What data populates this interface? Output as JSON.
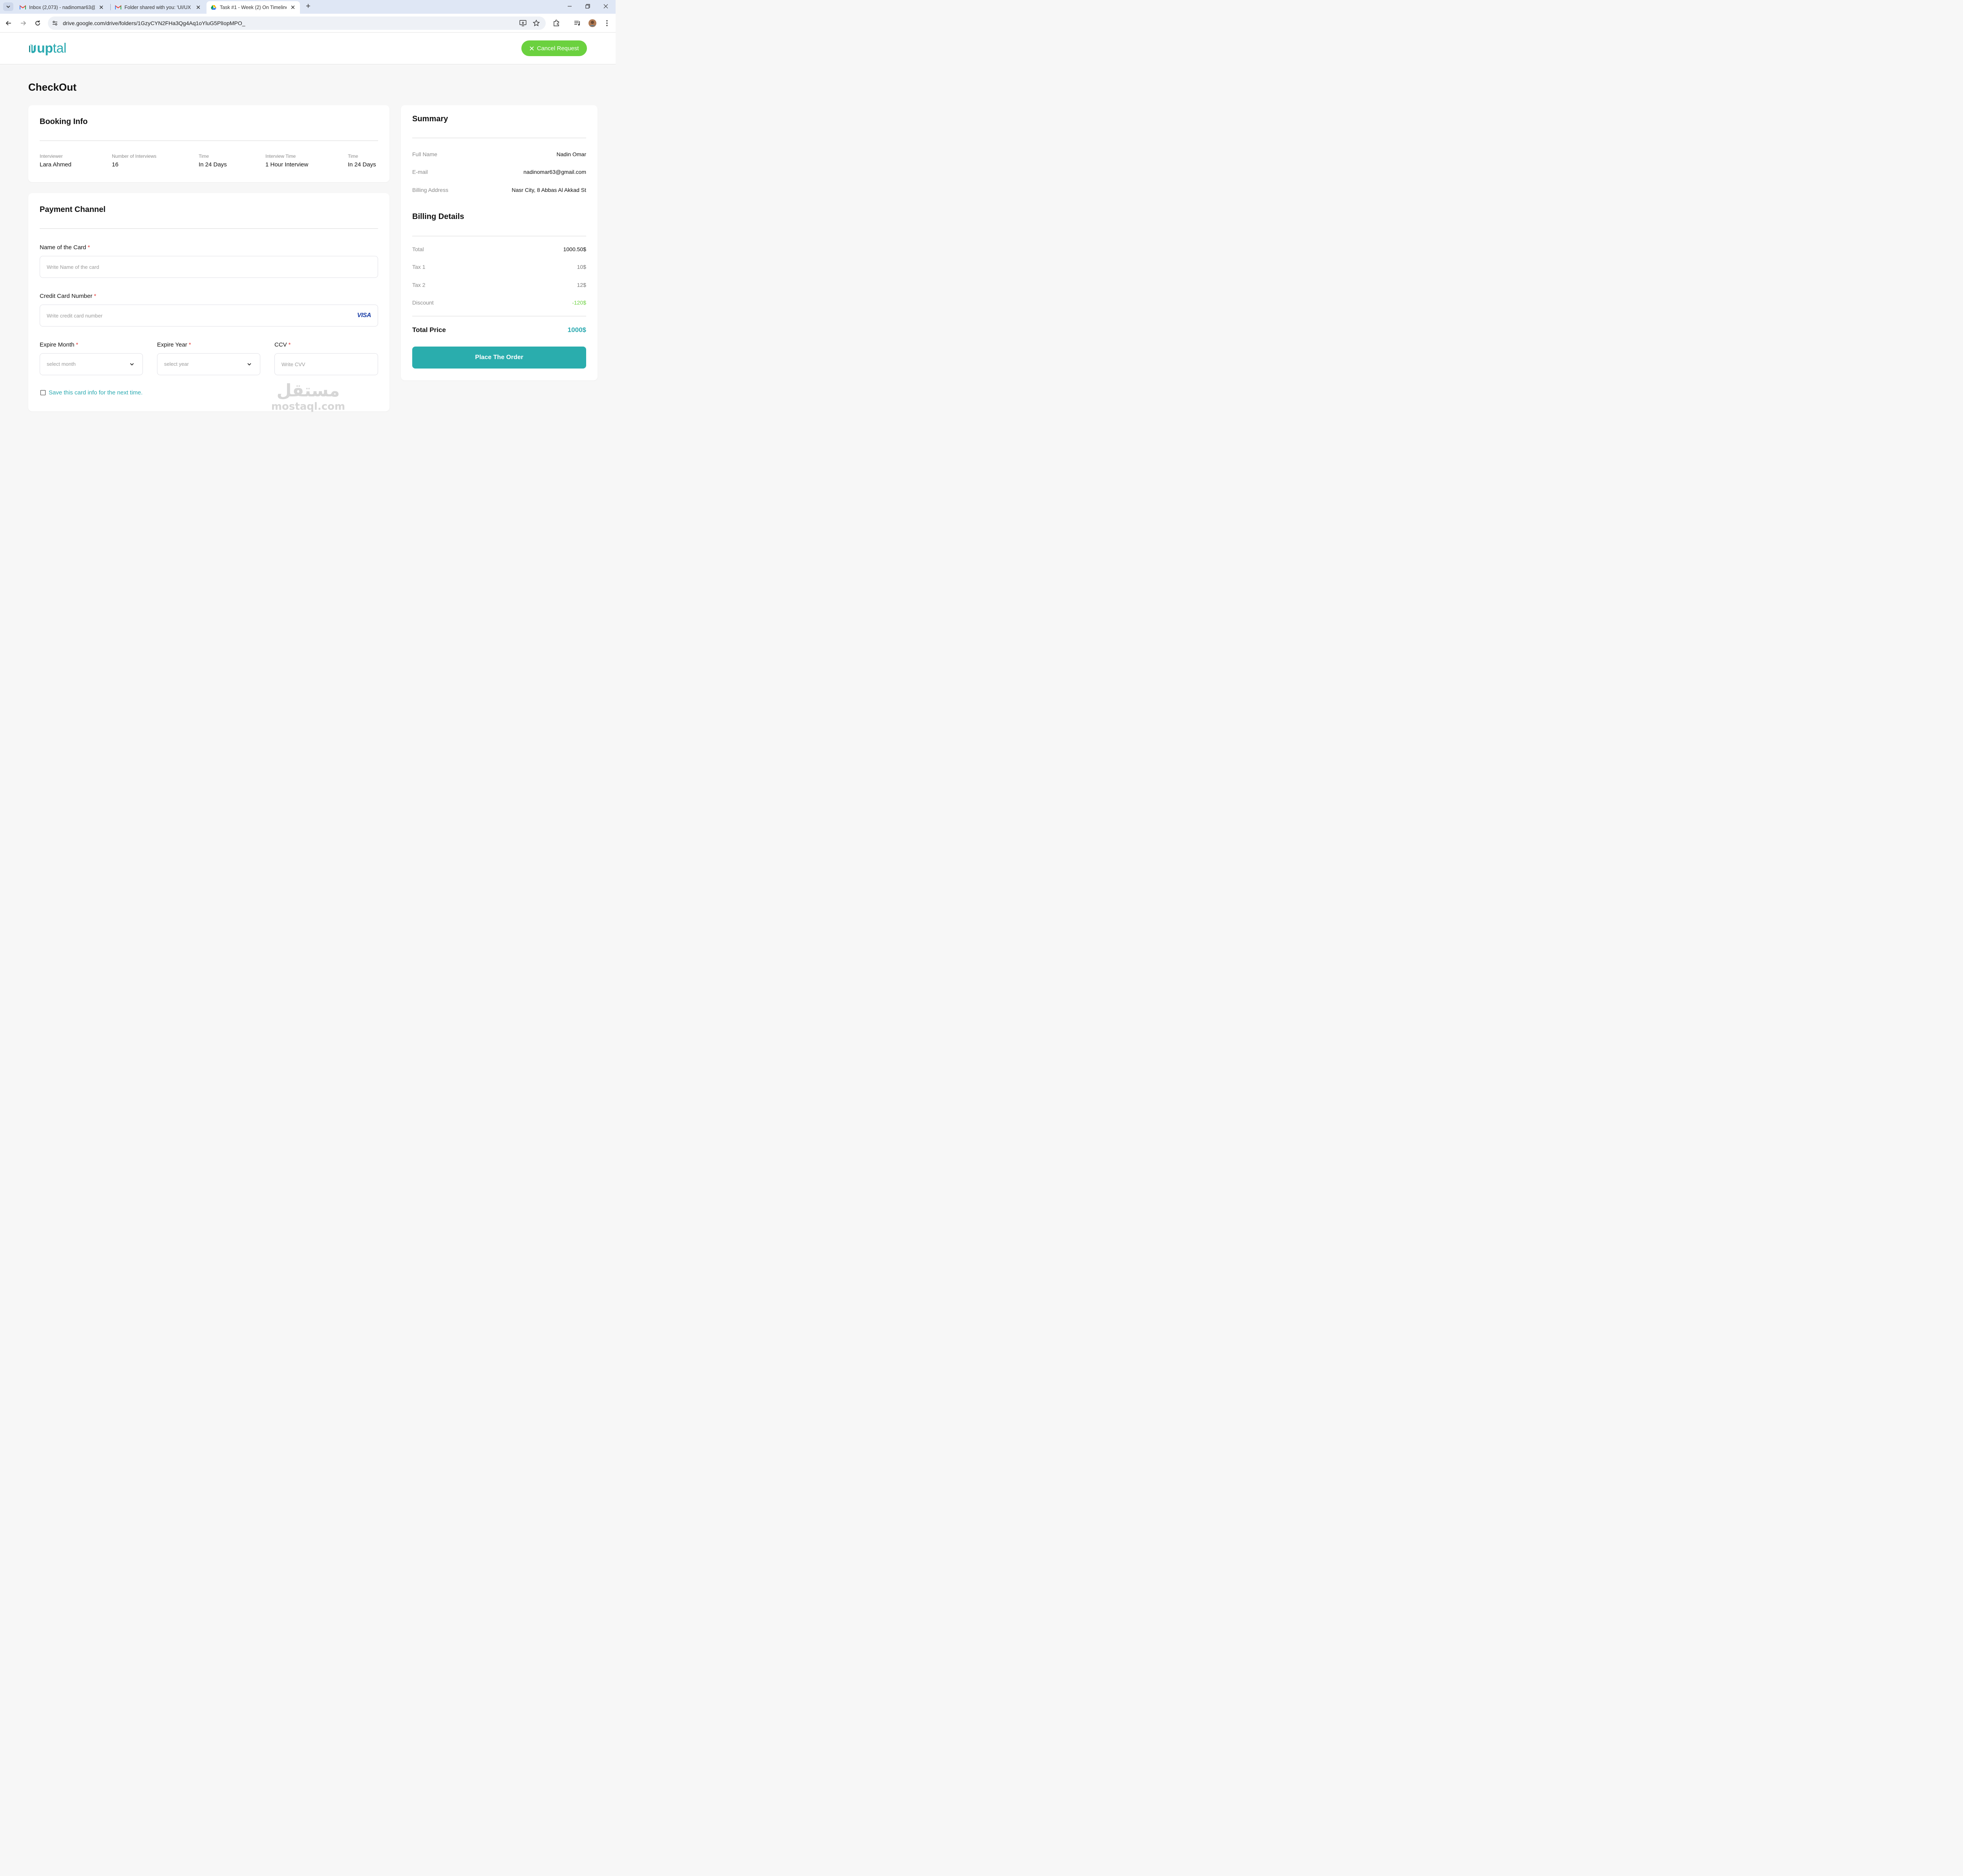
{
  "browser": {
    "tabs": [
      {
        "label": "Inbox (2,073) - nadinomar63@g",
        "icon": "gmail-icon",
        "active": false
      },
      {
        "label": "Folder shared with you: 'UI/UX I",
        "icon": "gmail-icon",
        "active": false
      },
      {
        "label": "Task #1 - Week (2) On Timeline",
        "icon": "google-drive-icon",
        "active": true
      }
    ],
    "url": "drive.google.com/drive/folders/1GzyCYN2FHa3Qg4Aq1oYluG5PlIopMPO_"
  },
  "header": {
    "logo_bold": "up",
    "logo_light": "tal",
    "cancel_label": "Cancel Request"
  },
  "page": {
    "title": "CheckOut"
  },
  "booking": {
    "title": "Booking Info",
    "items": [
      {
        "label": "Interviewer",
        "value": "Lara Ahmed"
      },
      {
        "label": "Number of Interviews",
        "value": "16"
      },
      {
        "label": "Time",
        "value": "In 24 Days"
      },
      {
        "label": "Interview Time",
        "value": "1 Hour Interview"
      },
      {
        "label": "Time",
        "value": "In 24 Days"
      }
    ]
  },
  "payment": {
    "title": "Payment Channel",
    "card_name": {
      "label": "Name of the Card",
      "required": "*",
      "placeholder": "Write Name of the card"
    },
    "card_number": {
      "label": "Credit Card Number",
      "required": "*",
      "placeholder": "Write credit card number",
      "brand": "VISA"
    },
    "expire_month": {
      "label": "Expire Month",
      "required": "*",
      "value": "select month"
    },
    "expire_year": {
      "label": "Expire Year",
      "required": "*",
      "value": "select year"
    },
    "ccv": {
      "label": "CCV",
      "required": "*",
      "placeholder": "Write CVV"
    },
    "save_label": "Save this card info for the next time."
  },
  "summary": {
    "title": "Summary",
    "rows": [
      {
        "label": "Full Name",
        "value": "Nadin Omar"
      },
      {
        "label": "E-mail",
        "value": "nadinomar63@gmail.com"
      },
      {
        "label": "Billing Address",
        "value": "Nasr City, 8 Abbas Al Akkad St"
      }
    ]
  },
  "billing": {
    "title": "Billing Details",
    "rows": [
      {
        "label": "Total",
        "value": "1000.50$"
      },
      {
        "label": "Tax 1",
        "value": "10$"
      },
      {
        "label": "Tax 2",
        "value": "12$"
      },
      {
        "label": "Discount",
        "value": "-120$"
      }
    ],
    "total_label": "Total Price",
    "total_value": "1000$",
    "place_order_label": "Place The Order"
  },
  "watermark": {
    "arabic": "مستقل",
    "latin": "mostaql.com"
  },
  "colors": {
    "brand_teal": "#2aa9b0",
    "accent_green": "#6bd13f",
    "required_red": "#e53935",
    "visa_blue": "#1a3ea6"
  }
}
